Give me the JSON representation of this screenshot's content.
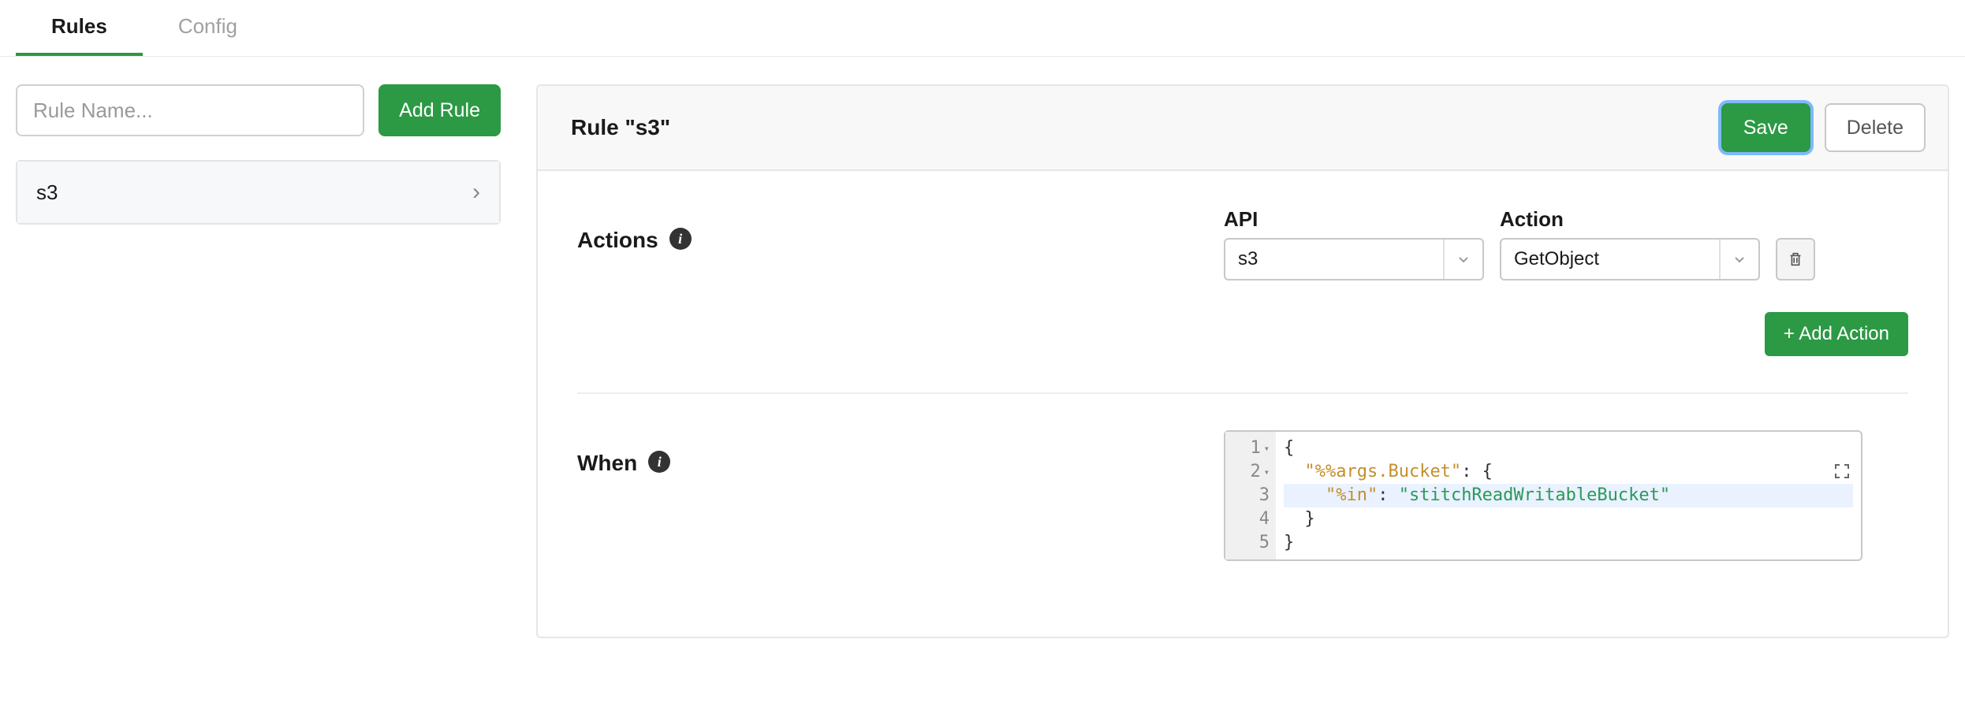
{
  "tabs": {
    "rules": "Rules",
    "config": "Config",
    "active": "rules"
  },
  "sidebar": {
    "input_placeholder": "Rule Name...",
    "add_button": "Add Rule",
    "rules": [
      {
        "name": "s3"
      }
    ]
  },
  "panel": {
    "title": "Rule \"s3\"",
    "save_label": "Save",
    "delete_label": "Delete"
  },
  "actions": {
    "label": "Actions",
    "api_label": "API",
    "action_label": "Action",
    "api_value": "s3",
    "action_value": "GetObject",
    "add_action_label": "+ Add Action"
  },
  "when": {
    "label": "When",
    "code": {
      "lines": [
        {
          "n": 1,
          "fold": true,
          "tokens": [
            {
              "t": "{",
              "c": "punc"
            }
          ]
        },
        {
          "n": 2,
          "fold": true,
          "tokens": [
            {
              "t": "  ",
              "c": "plain"
            },
            {
              "t": "\"%%args.Bucket\"",
              "c": "key"
            },
            {
              "t": ": {",
              "c": "punc"
            }
          ]
        },
        {
          "n": 3,
          "current": true,
          "tokens": [
            {
              "t": "    ",
              "c": "plain"
            },
            {
              "t": "\"%in\"",
              "c": "key"
            },
            {
              "t": ": ",
              "c": "punc"
            },
            {
              "t": "\"stitchReadWritableBucket\"",
              "c": "str"
            }
          ]
        },
        {
          "n": 4,
          "tokens": [
            {
              "t": "  }",
              "c": "punc"
            }
          ]
        },
        {
          "n": 5,
          "tokens": [
            {
              "t": "}",
              "c": "punc"
            }
          ]
        }
      ]
    }
  }
}
